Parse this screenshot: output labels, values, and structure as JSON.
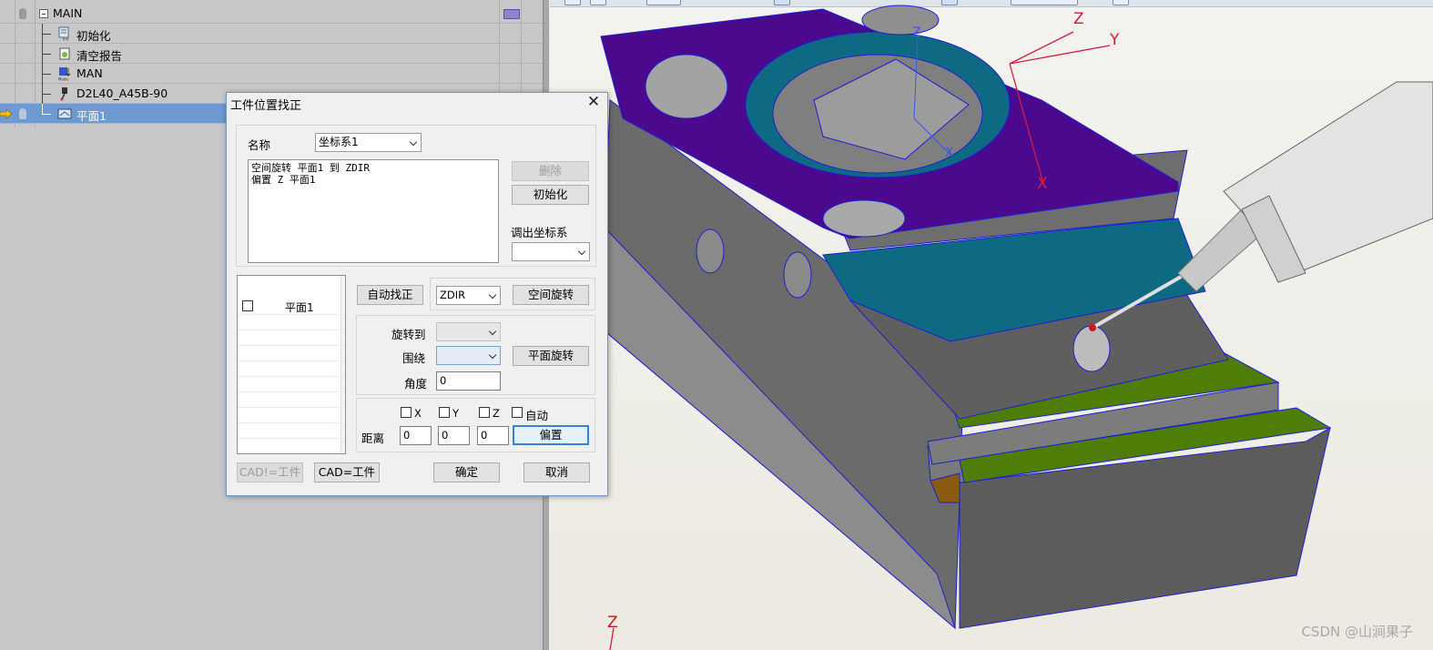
{
  "tree": {
    "items": [
      {
        "label": "MAIN",
        "depth": 0,
        "icon": "collapse-box-icon"
      },
      {
        "label": "初始化",
        "depth": 1,
        "icon": "init-icon"
      },
      {
        "label": "清空报告",
        "depth": 1,
        "icon": "clear-report-icon"
      },
      {
        "label": "MAN",
        "depth": 1,
        "icon": "manual-mode-icon"
      },
      {
        "label": "D2L40_A45B-90",
        "depth": 1,
        "icon": "probe-icon"
      },
      {
        "label": "平面1",
        "depth": 1,
        "icon": "plane-icon",
        "selected": true
      }
    ],
    "colors": {
      "selected": "#6c9bd2",
      "panel": "#c8c8c8"
    }
  },
  "dialog": {
    "title": "工件位置找正",
    "name_label": "名称",
    "name_value": "坐标系1",
    "log_lines": [
      "空间旋转 平面1 到 ZDIR",
      "偏置 Z 平面1"
    ],
    "delete_label": "删除",
    "init_label": "初始化",
    "recall_label": "调出坐标系",
    "recall_value": "",
    "list_items": [
      {
        "label": "平面1",
        "checked": false
      }
    ],
    "auto_align_label": "自动找正",
    "direction_value": "ZDIR",
    "spatial_rotate_label": "空间旋转",
    "rotate_to_label": "旋转到",
    "rotate_to_value": "",
    "around_label": "围绕",
    "around_value": "",
    "plane_rotate_label": "平面旋转",
    "angle_label": "角度",
    "angle_value": "0",
    "checks": [
      {
        "label": "X",
        "checked": false
      },
      {
        "label": "Y",
        "checked": false
      },
      {
        "label": "Z",
        "checked": false
      },
      {
        "label": "自动",
        "checked": false
      }
    ],
    "distance_label": "距离",
    "distances": [
      "0",
      "0",
      "0"
    ],
    "offset_label": "偏置",
    "cad_ne_label": "CAD!=工件",
    "cad_eq_label": "CAD=工件",
    "ok_label": "确定",
    "cancel_label": "取消"
  },
  "viewport": {
    "axis_z": "Z",
    "axis_y": "Y",
    "axis_x": "X",
    "part_axis_z": "Z",
    "part_axis_x": "X",
    "corner_z": "Z",
    "watermark": "CSDN @山涧果子",
    "colors": {
      "top": "#4b0a8e",
      "teal": "#0e6a82",
      "green": "#4e7e08",
      "steel": "#6a6a6a",
      "edge": "#1e1ed8"
    }
  }
}
